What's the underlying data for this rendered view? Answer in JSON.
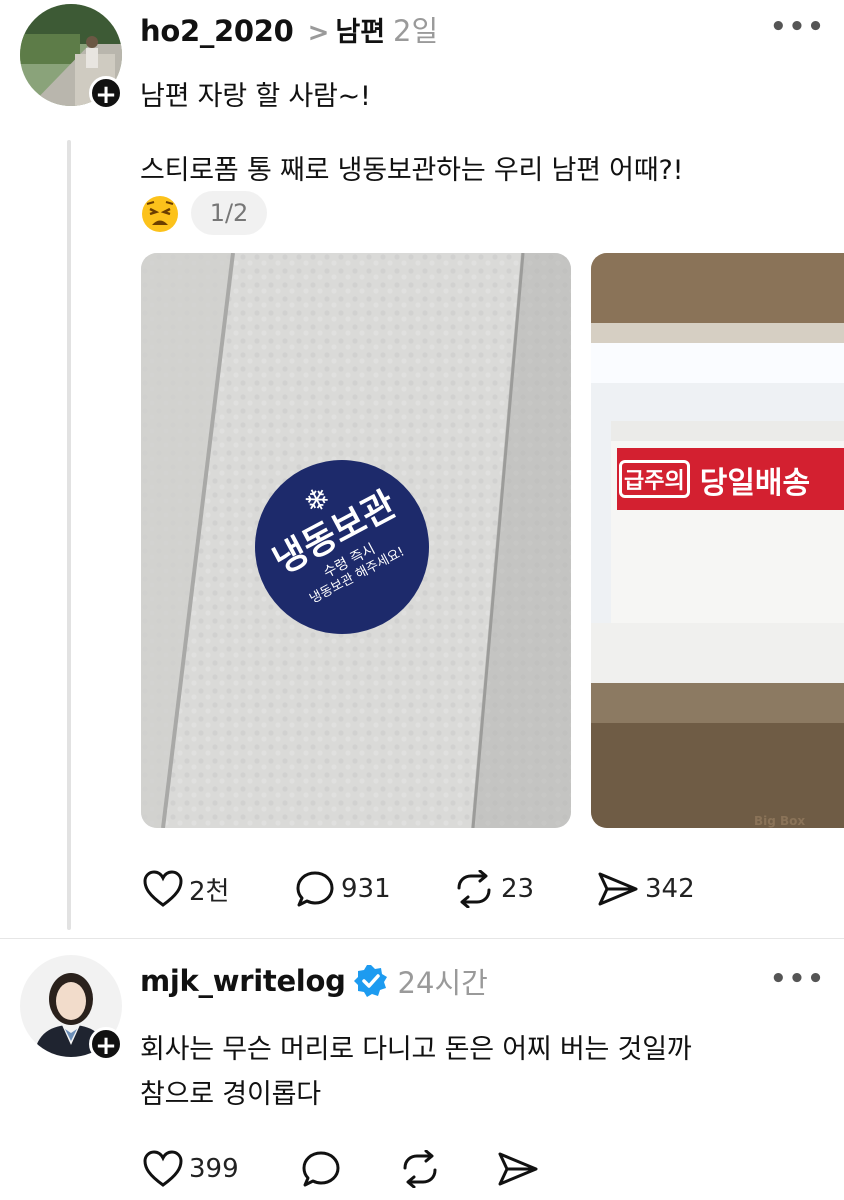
{
  "post": {
    "username": "ho2_2020",
    "replying_to": "남편",
    "time": "2일",
    "text": "남편 자랑 할 사람~!",
    "quoted_text": "스티로폼 통 째로 냉동보관하는 우리 남편 어때?!",
    "image_counter": "1/2",
    "images": [
      {
        "sticker_title": "냉동보관",
        "sticker_line1": "수령 즉시",
        "sticker_line2": "냉동보관 해주세요!"
      },
      {
        "tape_text_left": "급주의",
        "tape_text_right": "당일배송",
        "watermark": "Big Box"
      }
    ],
    "stats": {
      "likes": "2천",
      "comments": "931",
      "reposts": "23",
      "shares": "342"
    }
  },
  "comment": {
    "username": "mjk_writelog",
    "time": "24시간",
    "text_line1": "회사는 무슨 머리로 다니고 돈은 어찌 버는 것일까",
    "text_line2": "참으로 경이롭다",
    "stats": {
      "likes": "399"
    }
  },
  "icons": {
    "like": "heart-icon",
    "comment": "comment-bubble-icon",
    "repost": "repost-icon",
    "share": "send-icon",
    "verified": "verified-badge-icon",
    "more": "more-dots-icon",
    "follow": "plus-icon",
    "emoji": "weary-face-emoji"
  },
  "colors": {
    "verified": "#1d9bf0",
    "sticker": "#1d2a6b",
    "tape": "#d32030"
  }
}
